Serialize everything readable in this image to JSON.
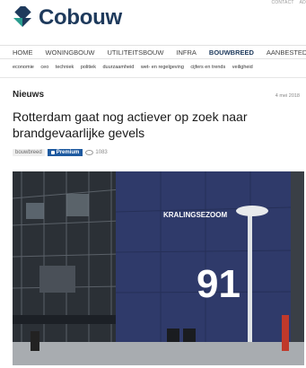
{
  "top_links": [
    "CONTACT",
    "AD"
  ],
  "logo_text": "Cobouw",
  "main_nav": [
    {
      "label": "HOME",
      "active": false
    },
    {
      "label": "WONINGBOUW",
      "active": false
    },
    {
      "label": "UTILITEITSBOUW",
      "active": false
    },
    {
      "label": "INFRA",
      "active": false
    },
    {
      "label": "BOUWBREED",
      "active": true
    },
    {
      "label": "AANBESTEDEN",
      "active": false
    }
  ],
  "sub_nav": [
    "economie",
    "ceo",
    "techniek",
    "politiek",
    "duurzaamheid",
    "wet- en regelgeving",
    "cijfers en trends",
    "veiligheid"
  ],
  "article": {
    "section": "Nieuws",
    "date": "4 mei 2018",
    "headline": "Rotterdam gaat nog actiever op zoek naar brandgevaarlijke gevels",
    "tag": "bouwbreed",
    "premium": "Premium",
    "views": "1083"
  },
  "photo": {
    "sign_text": "KRALINGSEZOOM",
    "number": "91"
  },
  "colors": {
    "brand": "#1e3a5c",
    "premium": "#1e5aa0",
    "logo_teal": "#2a9d8f"
  }
}
